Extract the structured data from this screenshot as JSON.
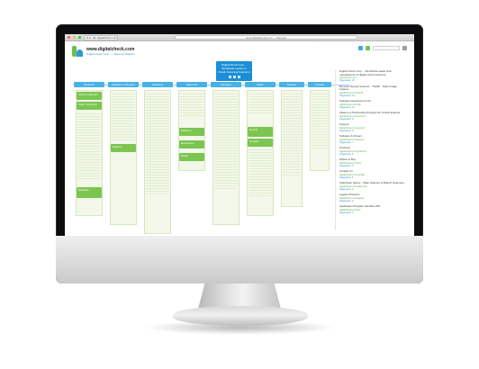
{
  "browser": {
    "tab_label": "D.H. tab digitalcheck.com",
    "url": "www.digitalcheck.com — Sitemap"
  },
  "site": {
    "brand_name": "www.digitalcheck.com",
    "brand_subtitle": "Digital Check Corp. — Sitemap Diagram"
  },
  "root_node": {
    "label": "Digital Check Corp. - Worldwide Leader in Check Scanning Solutions"
  },
  "columns": [
    {
      "label": "Products"
    },
    {
      "label": "Software & Support"
    },
    {
      "label": "Solutions"
    },
    {
      "label": "About Us"
    },
    {
      "label": "Partners"
    },
    {
      "label": "News"
    },
    {
      "label": "Support"
    },
    {
      "label": "Contact"
    }
  ],
  "green_cards": [
    {
      "label": "Check Scanners"
    },
    {
      "label": "Teller Scanners"
    },
    {
      "label": "Software"
    },
    {
      "label": "Support"
    },
    {
      "label": "Partners"
    },
    {
      "label": "Resources"
    },
    {
      "label": "News"
    },
    {
      "label": "Events"
    },
    {
      "label": "Contact"
    }
  ],
  "right_panel": {
    "items": [
      {
        "title": "Digital Check Corp. - Worldwide leader and manufacturer of digital check scanners",
        "link": "digitalcheck.com",
        "meta": "Pageviews: 20"
      },
      {
        "title": "Remote Deposit Scanner - TS240 - Teller Image Capture",
        "link": "digitalcheck.com/ts240",
        "meta": "Pageviews: 14"
      },
      {
        "title": "Software Development Kit",
        "link": "digitalcheck.com/sdk",
        "meta": "Pageviews: 11"
      },
      {
        "title": "Alliance & Partnership Program for Check Scanner",
        "link": "digitalcheck.com/partners",
        "meta": "Pageviews: 9"
      },
      {
        "title": "Support",
        "link": "digitalcheck.com/support",
        "meta": "Pageviews: 8"
      },
      {
        "title": "Software & Drivers",
        "link": "digitalcheck.com/drivers",
        "meta": "Pageviews: 7"
      },
      {
        "title": "Products",
        "link": "digitalcheck.com/products",
        "meta": "Pageviews: 6"
      },
      {
        "title": "Where to Buy",
        "link": "digitalcheck.com/buy",
        "meta": "Pageviews: 5"
      },
      {
        "title": "Contact Us",
        "link": "digitalcheck.com/contact",
        "meta": "Pageviews: 5"
      },
      {
        "title": "TellerScan Series - Teller Scanner & Branch Scanners",
        "link": "digitalcheck.com/tellerscan",
        "meta": "Pageviews: 4"
      },
      {
        "title": "Legacy Products",
        "link": "digitalcheck.com/legacy",
        "meta": "Pageviews: 3"
      },
      {
        "title": "Application Program Interface API",
        "link": "digitalcheck.com/api",
        "meta": "Pageviews: 3"
      }
    ]
  },
  "colors": {
    "accent_blue": "#1b8fd6",
    "column_blue": "#47b2e6",
    "card_green": "#7cc551",
    "bezel": "#0d0d0f"
  }
}
